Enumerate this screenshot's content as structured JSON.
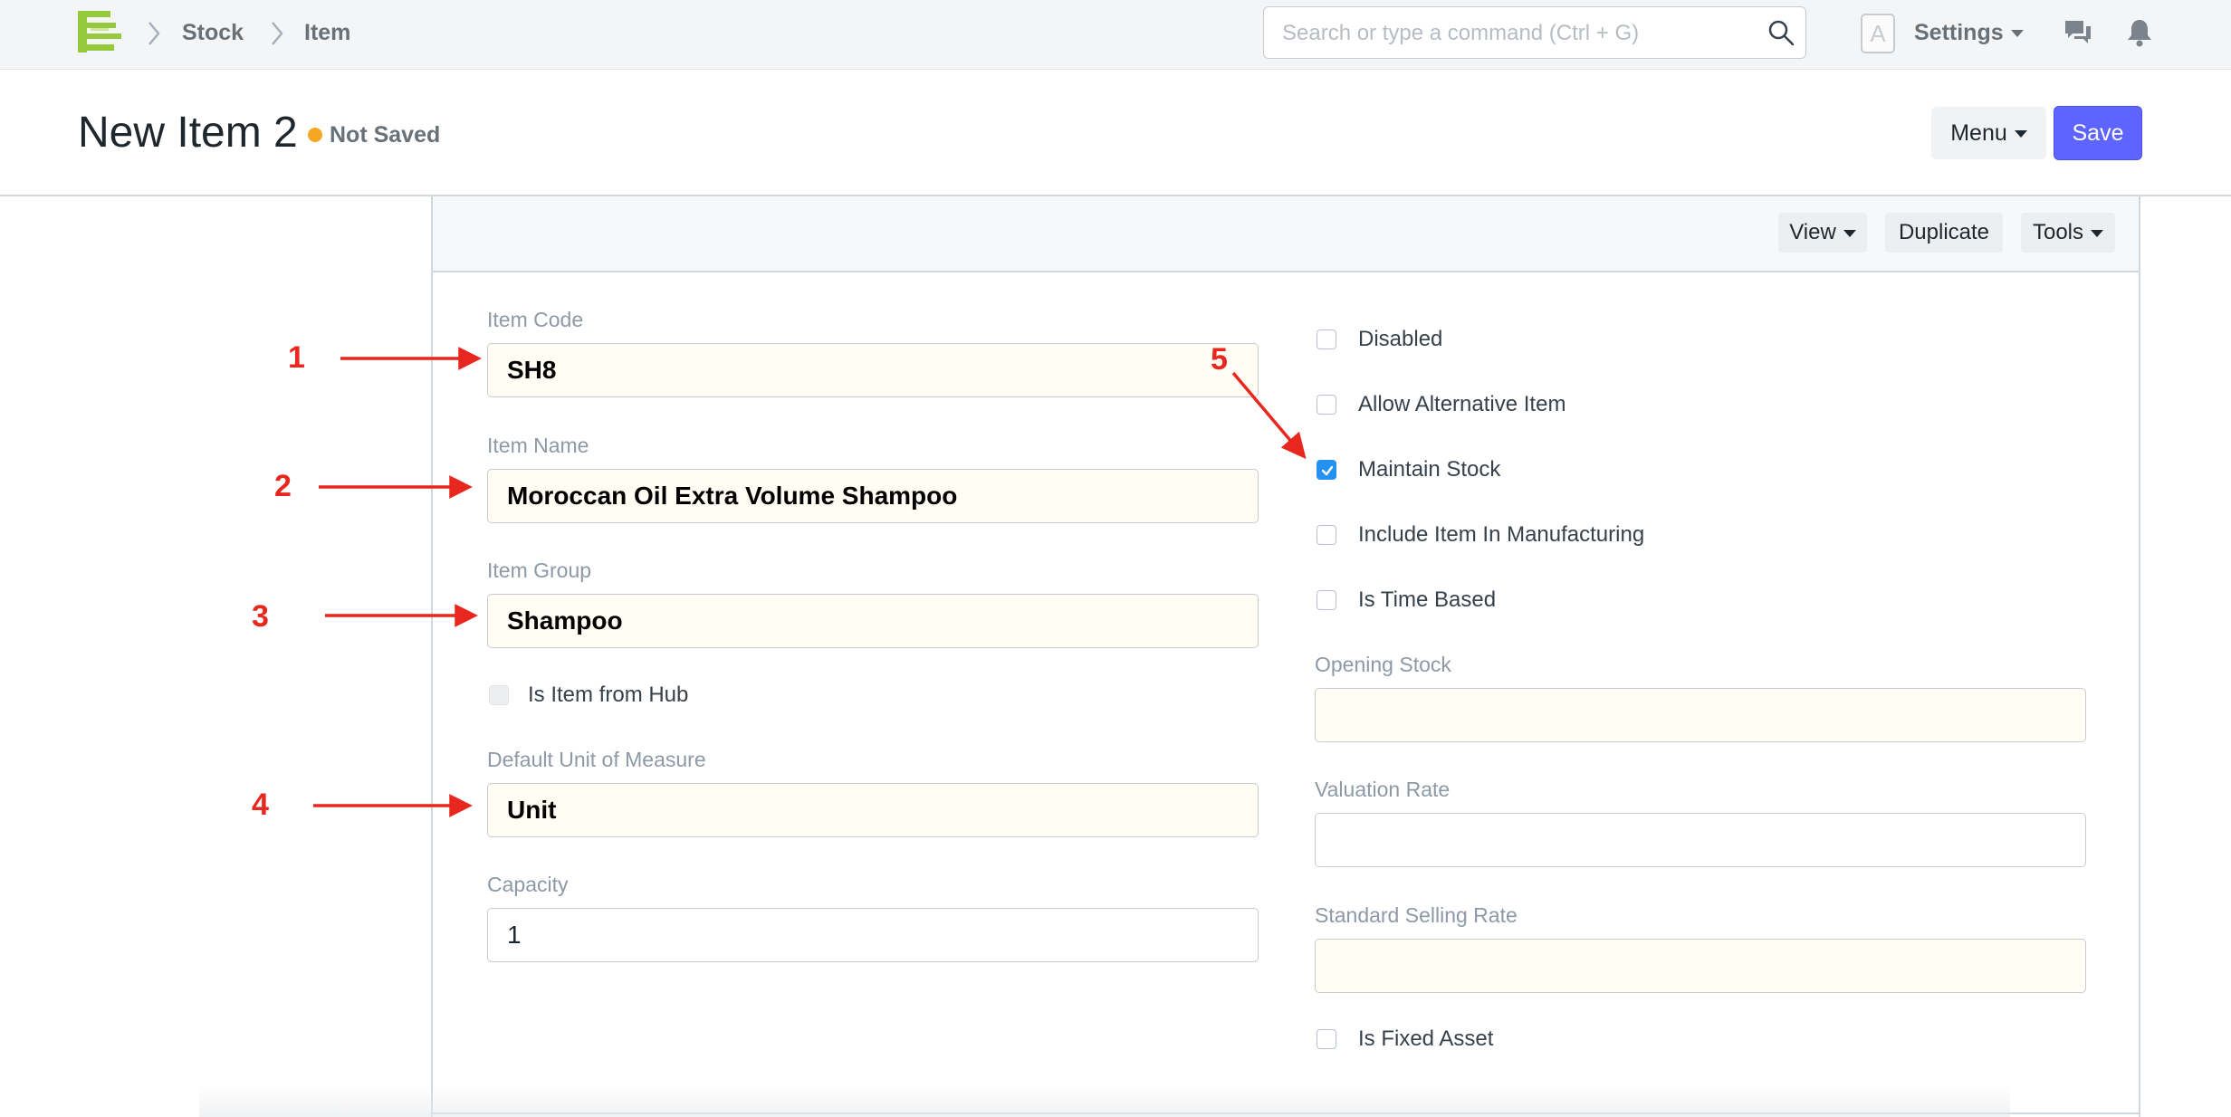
{
  "navbar": {
    "breadcrumbs": [
      "Stock",
      "Item"
    ],
    "search_placeholder": "Search or type a command (Ctrl + G)",
    "avatar_letter": "A",
    "settings_label": "Settings"
  },
  "page": {
    "title": "New Item 2",
    "status": "Not Saved",
    "menu_label": "Menu",
    "save_label": "Save",
    "status_color": "#f5a623",
    "primary_color": "#5e64ff"
  },
  "toolbar": {
    "view_label": "View",
    "duplicate_label": "Duplicate",
    "tools_label": "Tools"
  },
  "left_fields": {
    "item_code": {
      "label": "Item Code",
      "value": "SH8"
    },
    "item_name": {
      "label": "Item Name",
      "value": "Moroccan Oil Extra Volume Shampoo"
    },
    "item_group": {
      "label": "Item Group",
      "value": "Shampoo"
    },
    "is_item_from_hub": {
      "label": "Is Item from Hub",
      "checked": false
    },
    "default_uom": {
      "label": "Default Unit of Measure",
      "value": "Unit"
    },
    "capacity": {
      "label": "Capacity",
      "value": "1"
    }
  },
  "right_fields": {
    "disabled": {
      "label": "Disabled",
      "checked": false
    },
    "allow_alternative_item": {
      "label": "Allow Alternative Item",
      "checked": false
    },
    "maintain_stock": {
      "label": "Maintain Stock",
      "checked": true
    },
    "include_item_in_manufacturing": {
      "label": "Include Item In Manufacturing",
      "checked": false
    },
    "is_time_based": {
      "label": "Is Time Based",
      "checked": false
    },
    "opening_stock": {
      "label": "Opening Stock",
      "value": ""
    },
    "valuation_rate": {
      "label": "Valuation Rate",
      "value": ""
    },
    "standard_selling_rate": {
      "label": "Standard Selling Rate",
      "value": ""
    },
    "is_fixed_asset": {
      "label": "Is Fixed Asset",
      "checked": false
    }
  },
  "annotations": [
    "1",
    "2",
    "3",
    "4",
    "5"
  ],
  "annotation_color": "#e8271e"
}
